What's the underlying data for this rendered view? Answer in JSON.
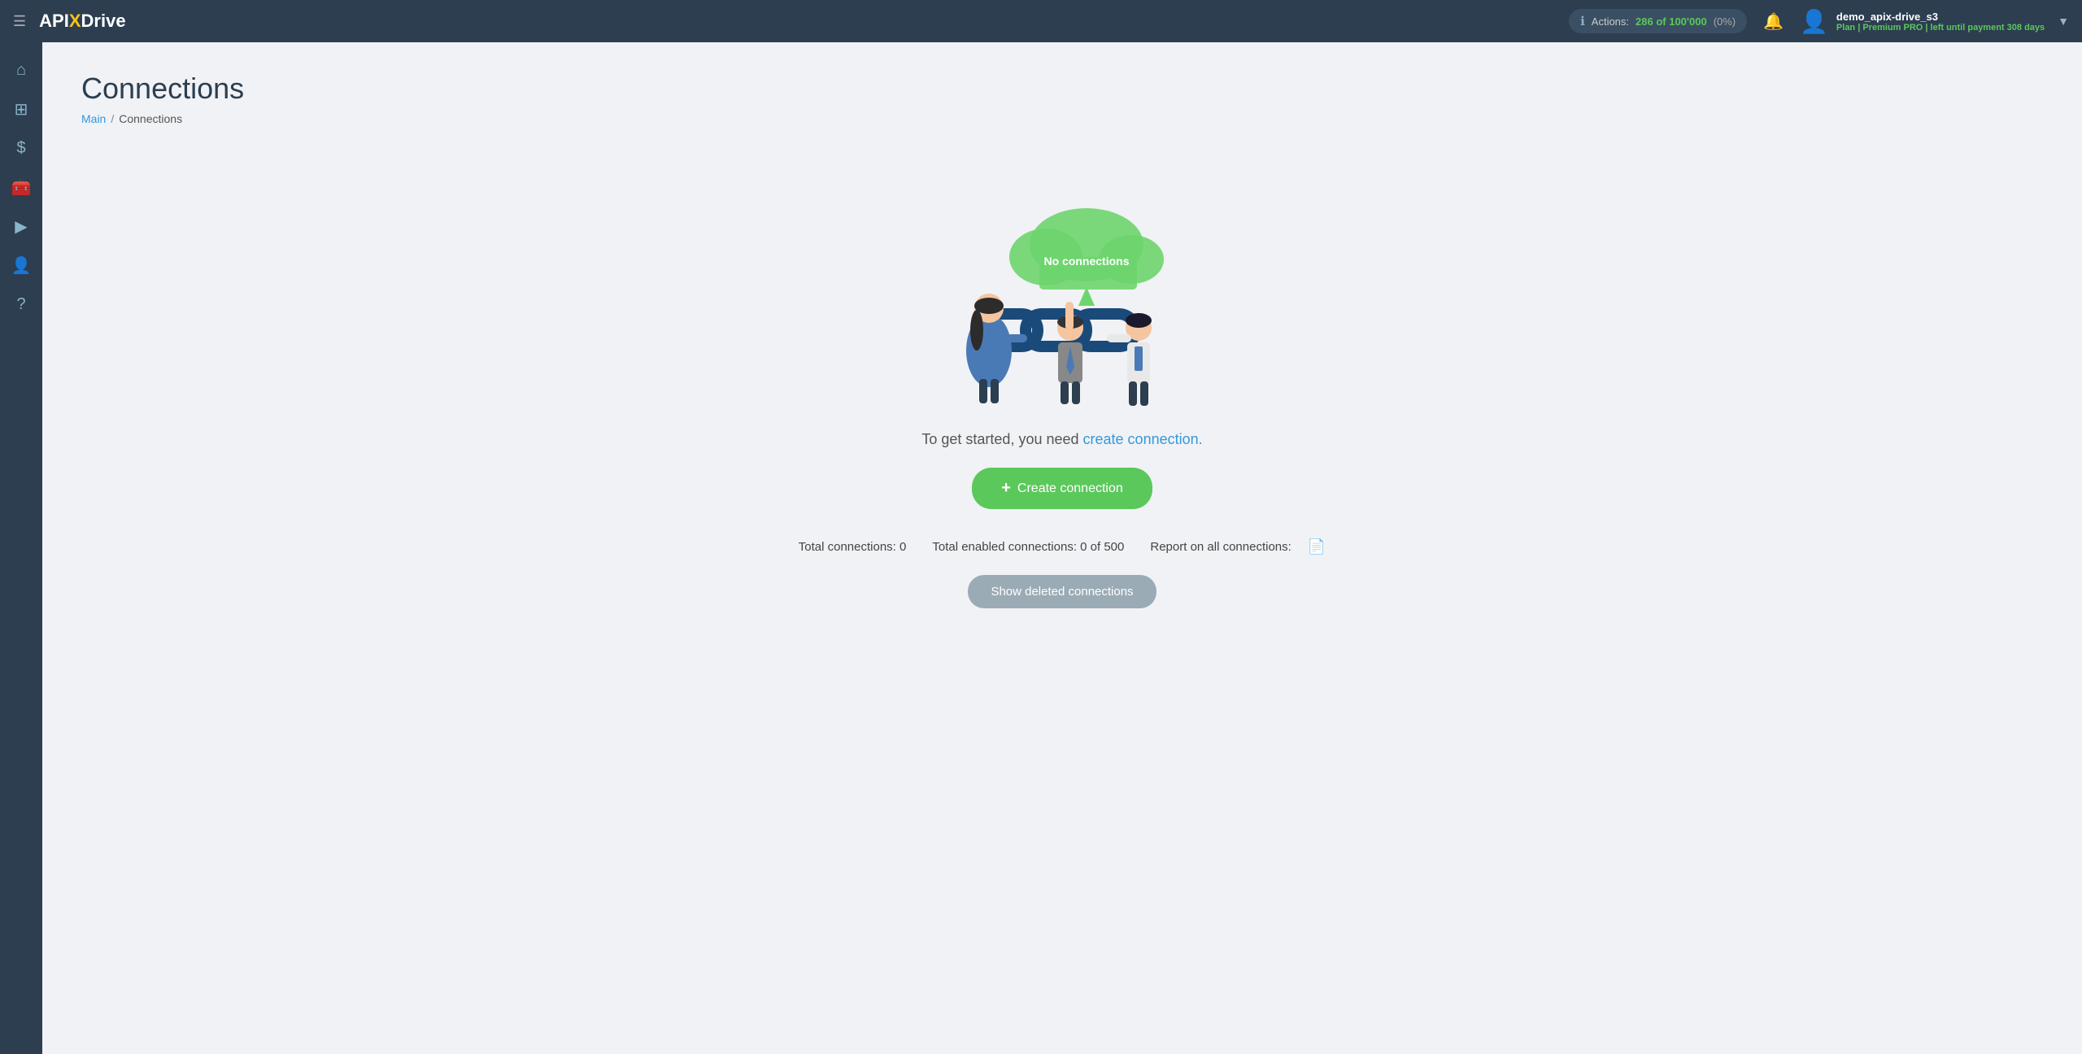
{
  "topnav": {
    "menu_icon": "☰",
    "logo": {
      "api": "API",
      "x": "X",
      "drive": "Drive"
    },
    "actions": {
      "label": "Actions:",
      "count": "286 of 100'000",
      "pct": "(0%)"
    },
    "bell_icon": "🔔",
    "user": {
      "name": "demo_apix-drive_s3",
      "plan_prefix": "Plan |",
      "plan_name": "Premium PRO",
      "plan_suffix": "| left until payment",
      "days": "308 days"
    },
    "chevron": "▼"
  },
  "sidebar": {
    "items": [
      {
        "icon": "⌂",
        "name": "home-icon",
        "active": false
      },
      {
        "icon": "⊞",
        "name": "dashboard-icon",
        "active": false
      },
      {
        "icon": "$",
        "name": "billing-icon",
        "active": false
      },
      {
        "icon": "🧰",
        "name": "tools-icon",
        "active": false
      },
      {
        "icon": "▶",
        "name": "play-icon",
        "active": false
      },
      {
        "icon": "👤",
        "name": "user-icon",
        "active": false
      },
      {
        "icon": "?",
        "name": "help-icon",
        "active": false
      }
    ]
  },
  "page": {
    "title": "Connections",
    "breadcrumb": {
      "main_label": "Main",
      "separator": "/",
      "current": "Connections"
    }
  },
  "content": {
    "no_connections_label": "No connections",
    "get_started_text": "To get started, you need",
    "create_link_text": "create connection.",
    "create_button": {
      "plus": "+",
      "label": "Create connection"
    },
    "stats": {
      "total_connections": "Total connections: 0",
      "total_enabled": "Total enabled connections: 0 of 500",
      "report_label": "Report on all connections:"
    },
    "show_deleted_button": "Show deleted connections"
  }
}
